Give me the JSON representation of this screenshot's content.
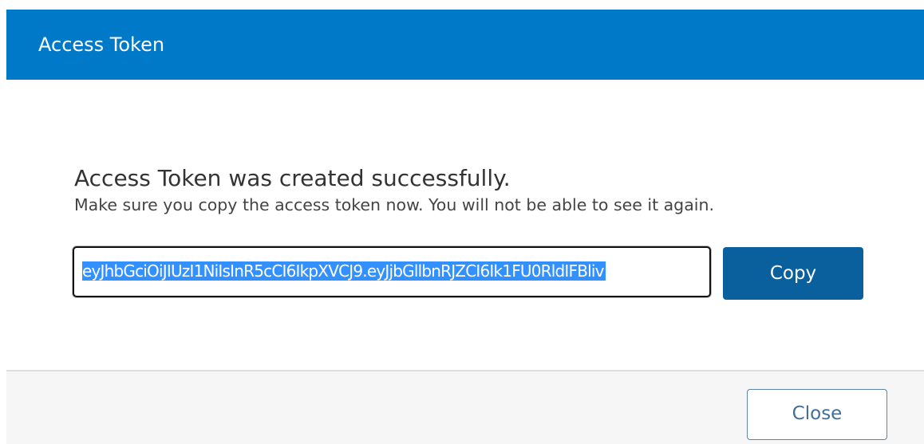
{
  "dialog": {
    "title": "Access Token",
    "header_color": "#0179c9"
  },
  "body": {
    "heading": "Access Token was created successfully.",
    "note": "Make sure you copy the access token now. You will not be able to see it again.",
    "token_value": "eyJhbGciOiJIUzI1NiIsInR5cCI6IkpXVCJ9.eyJjbGllbnRJZCI6Ik1FU0RldIFBliv",
    "token_selected": true,
    "copy_label": "Copy",
    "copy_button_color": "#0a5f9d"
  },
  "footer": {
    "close_label": "Close"
  }
}
